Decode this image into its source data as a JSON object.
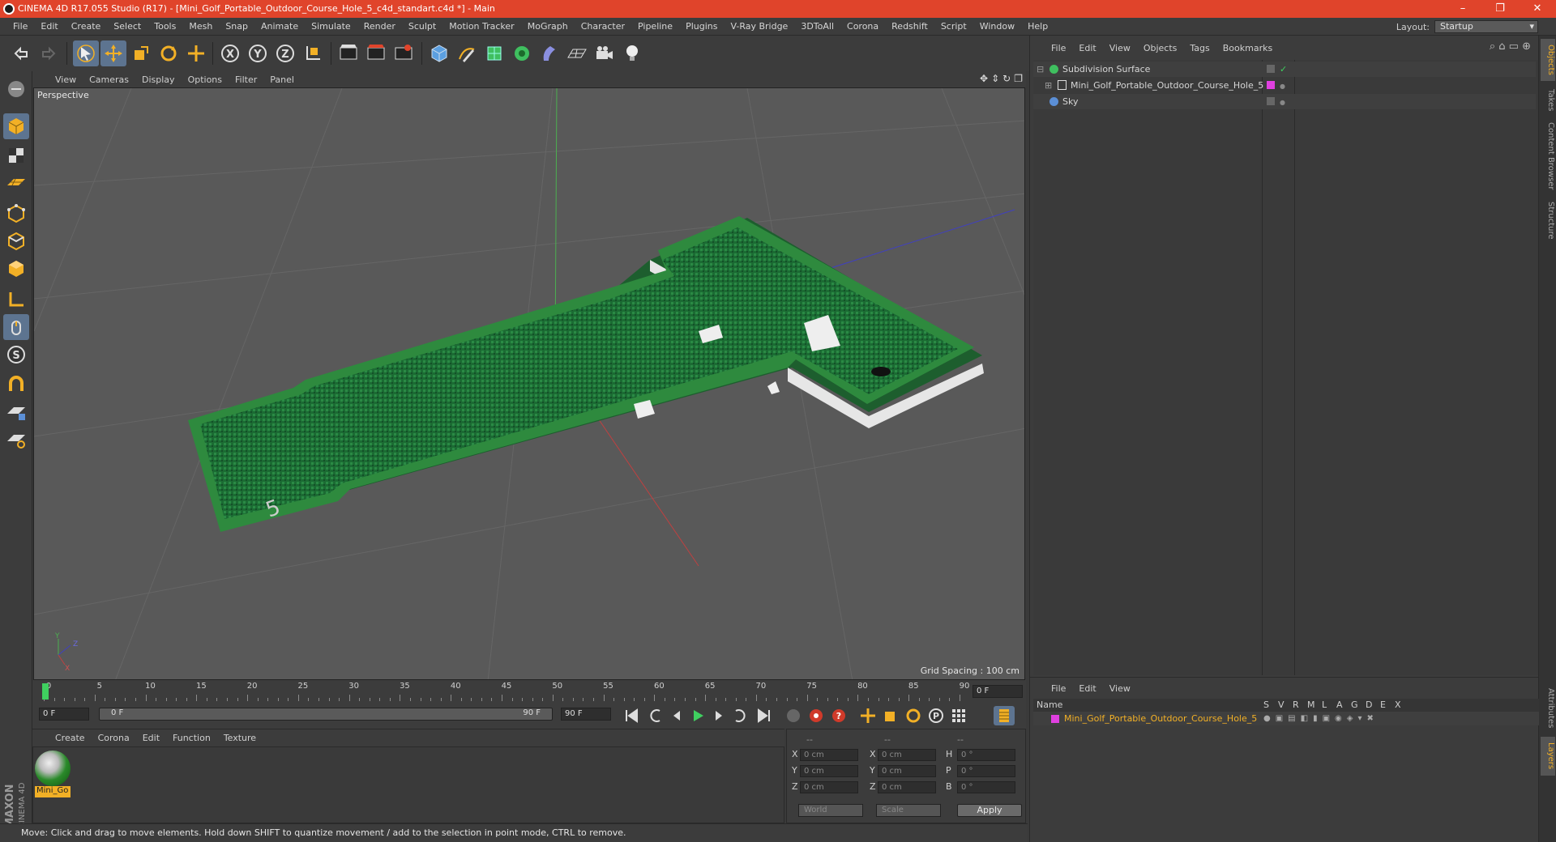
{
  "window": {
    "title": "CINEMA 4D R17.055 Studio (R17) - [Mini_Golf_Portable_Outdoor_Course_Hole_5_c4d_standart.c4d *] - Main",
    "controls": [
      "–",
      "❐",
      "✕"
    ]
  },
  "menubar": {
    "items": [
      "File",
      "Edit",
      "Create",
      "Select",
      "Tools",
      "Mesh",
      "Snap",
      "Animate",
      "Simulate",
      "Render",
      "Sculpt",
      "Motion Tracker",
      "MoGraph",
      "Character",
      "Pipeline",
      "Plugins",
      "V-Ray Bridge",
      "3DToAll",
      "Corona",
      "Redshift",
      "Script",
      "Window",
      "Help"
    ],
    "layout_label": "Layout:",
    "layout_value": "Startup"
  },
  "viewport": {
    "menu": [
      "View",
      "Cameras",
      "Display",
      "Options",
      "Filter",
      "Panel"
    ],
    "camera_label": "Perspective",
    "grid_spacing": "Grid Spacing : 100 cm",
    "axis_labels": [
      "Y",
      "Z",
      "X"
    ]
  },
  "timeline": {
    "ticks": [
      "0",
      "5",
      "10",
      "15",
      "20",
      "25",
      "30",
      "35",
      "40",
      "45",
      "50",
      "55",
      "60",
      "65",
      "70",
      "75",
      "80",
      "85",
      "90"
    ],
    "current_frame": "0 F",
    "start_field": "0 F",
    "range_start": "0 F",
    "range_end": "90 F",
    "end_field": "90 F"
  },
  "material_manager": {
    "menu": [
      "Create",
      "Corona",
      "Edit",
      "Function",
      "Texture"
    ],
    "materials": [
      {
        "name": "Mini_Go"
      }
    ]
  },
  "coordinates": {
    "headers": [
      "--",
      "--",
      "--"
    ],
    "rows": [
      {
        "pos_label": "X",
        "pos": "0 cm",
        "size_label": "X",
        "size": "0 cm",
        "rot_label": "H",
        "rot": "0 °"
      },
      {
        "pos_label": "Y",
        "pos": "0 cm",
        "size_label": "Y",
        "size": "0 cm",
        "rot_label": "P",
        "rot": "0 °"
      },
      {
        "pos_label": "Z",
        "pos": "0 cm",
        "size_label": "Z",
        "size": "0 cm",
        "rot_label": "B",
        "rot": "0 °"
      }
    ],
    "mode_world": "World",
    "mode_scale": "Scale",
    "apply": "Apply"
  },
  "statusbar": {
    "text": "Move: Click and drag to move elements. Hold down SHIFT to quantize movement / add to the selection in point mode, CTRL to remove."
  },
  "object_manager": {
    "menu": [
      "File",
      "Edit",
      "View",
      "Objects",
      "Tags",
      "Bookmarks"
    ],
    "objects": [
      {
        "name": "Subdivision Surface",
        "icon": "subdivision-icon",
        "color": "#3fbf5f"
      },
      {
        "name": "Mini_Golf_Portable_Outdoor_Course_Hole_5",
        "icon": "null-object-icon",
        "color": "#e040e0"
      },
      {
        "name": "Sky",
        "icon": "sky-icon",
        "color": "#5b8fd6"
      }
    ]
  },
  "side_tabs": [
    "Objects",
    "Takes",
    "Content Browser",
    "Structure"
  ],
  "side_tabs_bottom": [
    "Attributes",
    "Layers"
  ],
  "layer_manager": {
    "menu": [
      "File",
      "Edit",
      "View"
    ],
    "columns": [
      "Name",
      "S",
      "V",
      "R",
      "M",
      "L",
      "A",
      "G",
      "D",
      "E",
      "X"
    ],
    "layers": [
      {
        "name": "Mini_Golf_Portable_Outdoor_Course_Hole_5",
        "color": "#e040e0"
      }
    ]
  },
  "colors": {
    "title_bar": "#e0442b",
    "selection": "#5d7490",
    "accent_orange": "#f2b026"
  }
}
